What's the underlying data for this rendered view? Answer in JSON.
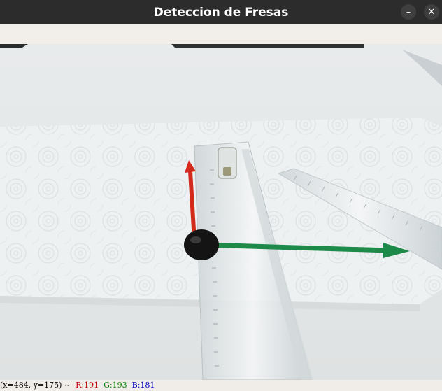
{
  "window": {
    "title": "Deteccion de Fresas",
    "minimize_glyph": "–",
    "close_glyph": "✕"
  },
  "status": {
    "coords": "(x=484, y=175) ~",
    "r": "R:191",
    "g": "G:193",
    "b": "B:181"
  },
  "colors": {
    "titlebar_bg": "#2c2c2c",
    "status_r": "#c00000",
    "status_g": "#008000",
    "status_b": "#0000c0",
    "axis_x": "#1e8a4a",
    "axis_y": "#d42a1c",
    "origin": "#111111"
  },
  "viewport": {
    "content": "camera-frame",
    "overlay": [
      "x-axis-arrow",
      "y-axis-arrow",
      "origin-marker"
    ]
  }
}
